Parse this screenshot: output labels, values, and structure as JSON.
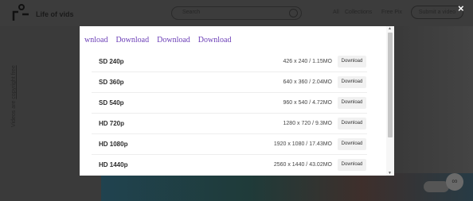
{
  "site": {
    "logo_text": "Life of vids",
    "search_placeholder": "Search",
    "nav": [
      "All",
      "Collections",
      "Free Pix"
    ],
    "submit_label": "Submit a video",
    "side_text_prefix": "Videos are ",
    "side_text_link": "copyright free"
  },
  "modal": {
    "download_links": [
      "wnload",
      "Download",
      "Download",
      "Download"
    ],
    "close_glyph": "×",
    "button_label": "Download",
    "rows": [
      {
        "label": "SD 240p",
        "info": "426 x 240 / 1.15MO"
      },
      {
        "label": "SD 360p",
        "info": "640 x 360 / 2.04MO"
      },
      {
        "label": "SD 540p",
        "info": "960 x 540 / 4.72MO"
      },
      {
        "label": "HD 720p",
        "info": "1280 x 720 / 9.3MO"
      },
      {
        "label": "HD 1080p",
        "info": "1920 x 1080 / 17.43MO"
      },
      {
        "label": "HD 1440p",
        "info": "2560 x 1440 / 43.02MO"
      }
    ]
  },
  "colors": {
    "link": "#6a3db6",
    "overlay": "#3a3a3a"
  }
}
